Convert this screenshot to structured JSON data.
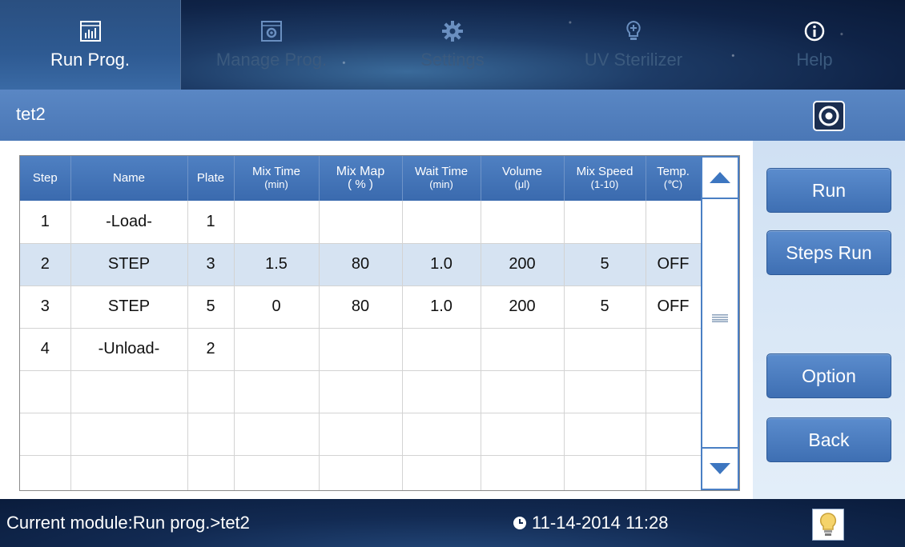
{
  "nav": {
    "tabs": [
      {
        "label": "Run Prog.",
        "icon": "chart-icon",
        "active": true
      },
      {
        "label": "Manage Prog.",
        "icon": "gear-box-icon",
        "active": false
      },
      {
        "label": "Settings",
        "icon": "gear-icon",
        "active": false
      },
      {
        "label": "UV Sterilizer",
        "icon": "bulb-icon",
        "active": false
      },
      {
        "label": "Help",
        "icon": "info-icon",
        "active": false
      }
    ]
  },
  "header": {
    "program_name": "tet2"
  },
  "table": {
    "columns": [
      {
        "label": "Step",
        "unit": ""
      },
      {
        "label": "Name",
        "unit": ""
      },
      {
        "label": "Plate",
        "unit": ""
      },
      {
        "label": "Mix Time",
        "unit": "(min)"
      },
      {
        "label": "Mix Map",
        "unit": "( % )"
      },
      {
        "label": "Wait Time",
        "unit": "(min)"
      },
      {
        "label": "Volume",
        "unit": "(μl)"
      },
      {
        "label": "Mix Speed",
        "unit": "(1-10)"
      },
      {
        "label": "Temp.",
        "unit": "(℃)"
      }
    ],
    "rows": [
      {
        "step": "1",
        "name": "-Load-",
        "plate": "1",
        "mix_time": "",
        "mix_map": "",
        "wait_time": "",
        "volume": "",
        "mix_speed": "",
        "temp": ""
      },
      {
        "step": "2",
        "name": "STEP",
        "plate": "3",
        "mix_time": "1.5",
        "mix_map": "80",
        "wait_time": "1.0",
        "volume": "200",
        "mix_speed": "5",
        "temp": "OFF"
      },
      {
        "step": "3",
        "name": "STEP",
        "plate": "5",
        "mix_time": "0",
        "mix_map": "80",
        "wait_time": "1.0",
        "volume": "200",
        "mix_speed": "5",
        "temp": "OFF"
      },
      {
        "step": "4",
        "name": "-Unload-",
        "plate": "2",
        "mix_time": "",
        "mix_map": "",
        "wait_time": "",
        "volume": "",
        "mix_speed": "",
        "temp": ""
      }
    ],
    "selected_row": 1
  },
  "side_buttons": {
    "run": "Run",
    "steps_run": "Steps Run",
    "option": "Option",
    "back": "Back"
  },
  "status": {
    "module_text": "Current module:Run prog.>tet2",
    "datetime": "11-14-2014 11:28"
  },
  "colors": {
    "accent": "#4a77b6",
    "nav_bg": "#0f2347",
    "selected_row": "#d6e3f2",
    "button": "#4a7cbf"
  }
}
